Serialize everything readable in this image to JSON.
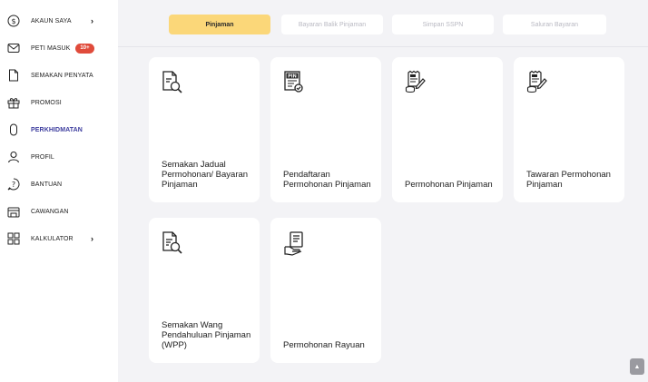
{
  "sidebar": {
    "items": [
      {
        "label": "AKAUN SAYA",
        "icon": "dollar-circle-icon",
        "chevron": "›"
      },
      {
        "label": "PETI MASUK",
        "icon": "mail-icon",
        "badge": "10+"
      },
      {
        "label": "SEMAKAN PENYATA",
        "icon": "document-icon"
      },
      {
        "label": "PROMOSI",
        "icon": "gift-icon"
      },
      {
        "label": "PERKHIDMATAN",
        "icon": "capsule-icon"
      },
      {
        "label": "PROFIL",
        "icon": "user-icon"
      },
      {
        "label": "BANTUAN",
        "icon": "help-icon"
      },
      {
        "label": "CAWANGAN",
        "icon": "branch-icon"
      },
      {
        "label": "KALKULATOR",
        "icon": "calculator-icon",
        "chevron": "›"
      }
    ]
  },
  "tabs": [
    {
      "label": "Pinjaman"
    },
    {
      "label": "Bayaran Balik Pinjaman"
    },
    {
      "label": "Simpan SSPN"
    },
    {
      "label": "Saluran Bayaran"
    }
  ],
  "cards": [
    {
      "title": "Semakan Jadual Permohonan/ Bayaran Pinjaman",
      "icon": "document-search-icon"
    },
    {
      "title": "Pendaftaran Permohonan Pinjaman",
      "icon": "pin-document-icon"
    },
    {
      "title": "Permohonan Pinjaman",
      "icon": "loan-application-icon"
    },
    {
      "title": "Tawaran Permohonan Pinjaman",
      "icon": "loan-offer-icon"
    },
    {
      "title": "Semakan Wang Pendahuluan Pinjaman (WPP)",
      "icon": "wpp-search-icon"
    },
    {
      "title": "Permohonan Rayuan",
      "icon": "appeal-document-icon"
    }
  ],
  "colors": {
    "accent": "#fbd779",
    "active_nav": "#3d3d9e",
    "badge": "#e04b3b",
    "background": "#f3f3f6"
  },
  "scroll_top_icon": "chevron-up-icon"
}
